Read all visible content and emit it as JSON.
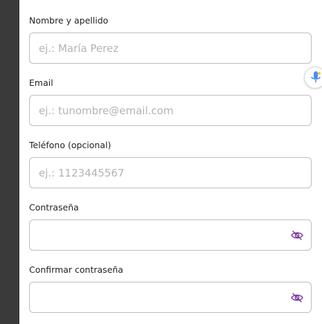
{
  "form": {
    "fields": [
      {
        "label": "Nombre y apellido",
        "placeholder": "ej.: María Perez",
        "value": ""
      },
      {
        "label": "Email",
        "placeholder": "ej.: tunombre@email.com",
        "value": ""
      },
      {
        "label": "Teléfono (opcional)",
        "placeholder": "ej.: 1123445567",
        "value": ""
      },
      {
        "label": "Contraseña",
        "placeholder": "",
        "value": "",
        "icon": "eye-off-icon"
      },
      {
        "label": "Confirmar contraseña",
        "placeholder": "",
        "value": "",
        "icon": "eye-off-icon"
      }
    ]
  },
  "mic": {
    "icon": "microphone-icon"
  },
  "colors": {
    "sidebar": "#3a3a3a",
    "border": "#bdbdbd",
    "placeholder": "#b3b3b3",
    "eye_icon": "#7b3fa0",
    "mic_blue": "#4a8df6",
    "mic_yellow": "#f7c948"
  }
}
